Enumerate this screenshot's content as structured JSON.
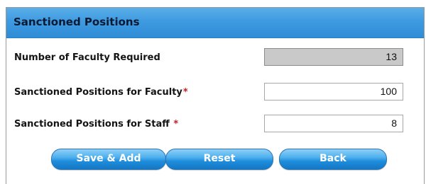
{
  "panel": {
    "title": "Sanctioned Positions"
  },
  "fields": {
    "faculty_required": {
      "label": "Number of Faculty Required",
      "value": "13"
    },
    "positions_faculty": {
      "label": "Sanctioned Positions for Faculty",
      "required_marker": "*",
      "value": "100"
    },
    "positions_staff": {
      "label": "Sanctioned Positions for Staff",
      "required_marker": "*",
      "value": "8"
    }
  },
  "buttons": {
    "save_add": "Save & Add",
    "reset": "Reset",
    "back": "Back"
  },
  "colors": {
    "header": "#3f9ae0",
    "button": "#1f8ddc",
    "required": "#c0202a",
    "readonly_field": "#c9c9c9"
  }
}
